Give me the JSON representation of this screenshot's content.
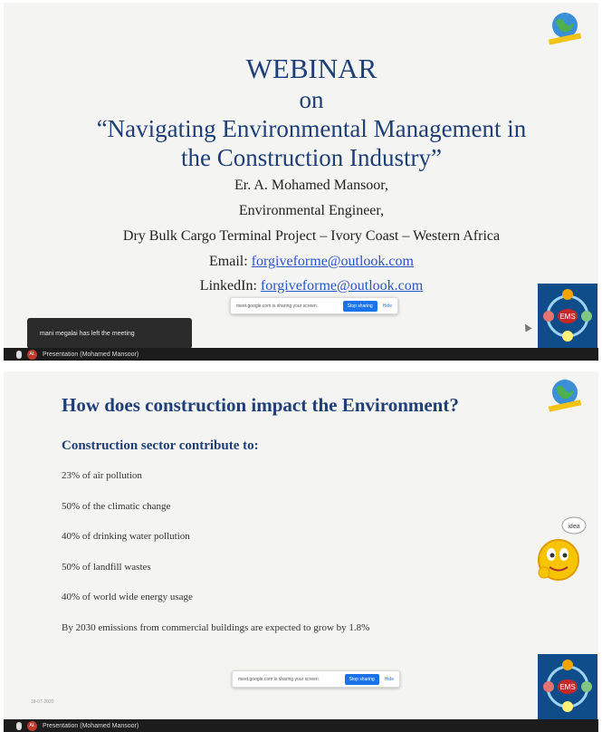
{
  "slide1": {
    "heading": "WEBINAR",
    "on": "on",
    "topic_line1": "“Navigating Environmental Management in",
    "topic_line2": "the Construction Industry”",
    "presenter": "Er. A. Mohamed Mansoor,",
    "role": "Environmental Engineer,",
    "project": "Dry Bulk Cargo Terminal Project – Ivory Coast – Western Africa",
    "email_label": "Email:",
    "email": "forgiveforme@outlook.com",
    "linkedin_label": "LinkedIn:",
    "linkedin": "forgiveforme@outlook.com"
  },
  "share_bar": {
    "message": "meet.google.com is sharing your screen.",
    "stop_label": "Stop sharing",
    "hide_label": "Hide"
  },
  "toast": {
    "text": "mani megalai has left the meeting"
  },
  "taskbar": {
    "presenter_initials": "AL",
    "presentation_label": "Presentation (Mohamed Mansoor)"
  },
  "slide2": {
    "title": "How does construction impact the Environment?",
    "subtitle": "Construction sector contribute to:",
    "items": [
      "23% of air pollution",
      "50% of the climatic change",
      "40% of drinking water pollution",
      "50% of landfill wastes",
      "40% of world wide energy usage",
      "By 2030 emissions from commercial buildings are expected to grow by 1.8%"
    ],
    "date": "18-07-2020",
    "idea_bubble": "idea"
  },
  "logos": {
    "ems_text": "EMS"
  },
  "colors": {
    "title_blue": "#1f3f78",
    "link_blue": "#2a55c8",
    "taskbar": "#1c1c1c"
  }
}
